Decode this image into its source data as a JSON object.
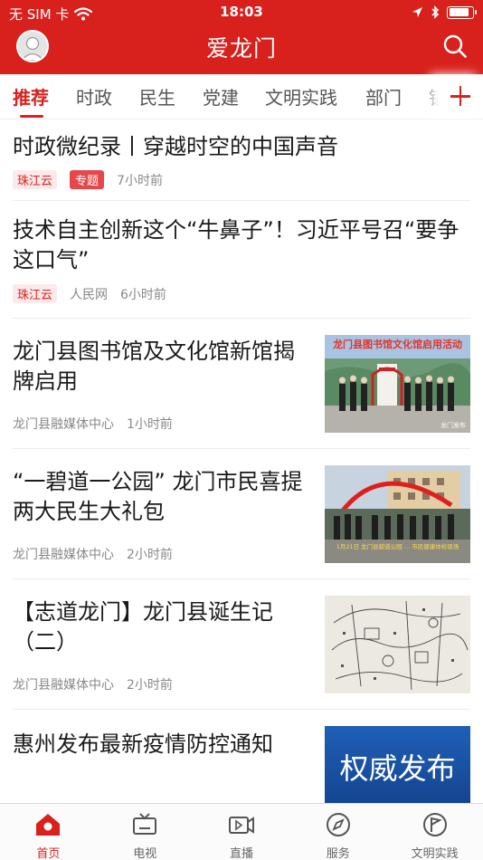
{
  "status_bar": {
    "carrier": "无 SIM 卡",
    "time": "18:03",
    "battery_level": 0.9
  },
  "header": {
    "title": "爱龙门"
  },
  "tabs": [
    {
      "label": "推荐"
    },
    {
      "label": "时政"
    },
    {
      "label": "民生"
    },
    {
      "label": "党建"
    },
    {
      "label": "文明实践"
    },
    {
      "label": "部门"
    },
    {
      "label": "镇"
    }
  ],
  "articles": [
    {
      "title": "时政微纪录丨穿越时空的中国声音",
      "source_tag": "珠江云",
      "topic_tag": "专题",
      "time": "7小时前"
    },
    {
      "title": "技术自主创新这个“牛鼻子”！习近平号召“要争这口气”",
      "source_tag": "珠江云",
      "source": "人民网",
      "time": "6小时前"
    },
    {
      "title": "龙门县图书馆及文化馆新馆揭牌启用",
      "source": "龙门县融媒体中心",
      "time": "1小时前",
      "image_caption": "龙门县图书馆文化馆启用活动",
      "image_watermark": "龙门发布"
    },
    {
      "title": "“一碧道一公园” 龙门市民喜提两大民生大礼包",
      "source": "龙门县融媒体中心",
      "time": "2小时前",
      "image_caption": "1月21日 龙门县碧道公园 … 市民健康体检现场"
    },
    {
      "title": "【志道龙门】龙门县诞生记（二）",
      "source": "龙门县融媒体中心",
      "time": "2小时前"
    },
    {
      "title": "惠州发布最新疫情防控通知",
      "image_caption": "权威发布"
    }
  ],
  "tabbar": [
    {
      "label": "首页",
      "icon": "home-icon"
    },
    {
      "label": "电视",
      "icon": "tv-icon"
    },
    {
      "label": "直播",
      "icon": "live-icon"
    },
    {
      "label": "服务",
      "icon": "compass-icon"
    },
    {
      "label": "文明实践",
      "icon": "flag-icon"
    }
  ],
  "colors": {
    "brand": "#d8211d",
    "tag_bg": "#fbeaea",
    "topic_tag": "#e5474a"
  }
}
